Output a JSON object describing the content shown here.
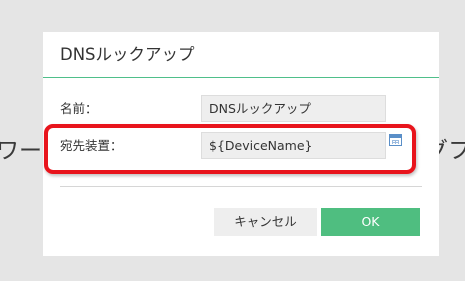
{
  "background": {
    "left_fragment": "ワー・",
    "right_fragment": "グフ"
  },
  "dialog": {
    "title": "DNSルックアップ",
    "fields": {
      "name_label": "名前：",
      "name_value": "DNSルックアップ",
      "destination_label": "宛先装置：",
      "destination_value": "${DeviceName}",
      "destination_icon": "calendar-icon"
    },
    "buttons": {
      "cancel_label": "キャンセル",
      "ok_label": "OK"
    }
  },
  "colors": {
    "accent_green": "#4fbe80",
    "highlight_red": "#e8141c",
    "backdrop": "#e5e5e5"
  }
}
